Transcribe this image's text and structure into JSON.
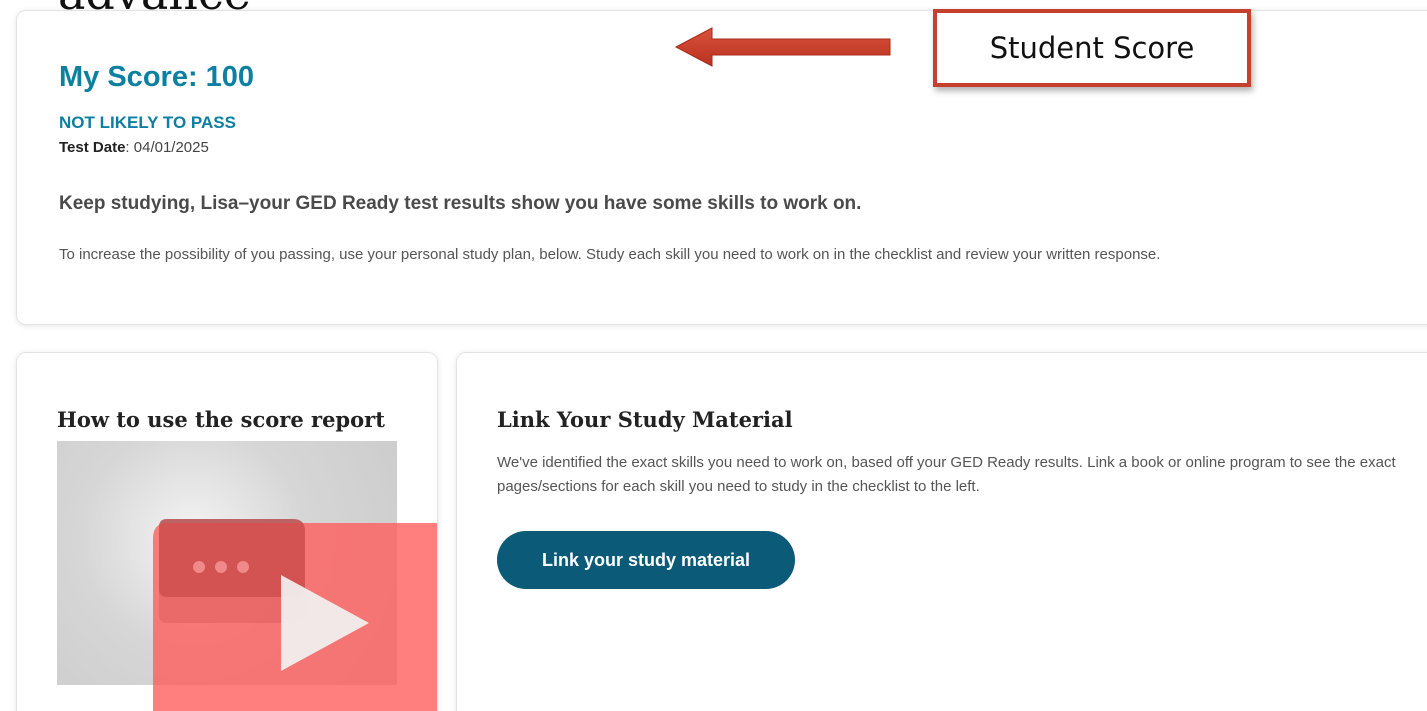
{
  "header": {
    "cropped_heading": "advance"
  },
  "score": {
    "title": "My Score: 100",
    "status": "NOT LIKELY TO PASS",
    "date_label": "Test Date",
    "date_value": ": 04/01/2025",
    "message_heading": "Keep studying, Lisa–your GED Ready test results show you have some skills to work on.",
    "message_body": "To increase the possibility of you passing, use your personal study plan, below. Study each skill you need to work on in the checklist and review your written response."
  },
  "annotation": {
    "label": "Student Score",
    "color": "#c7402f"
  },
  "video": {
    "title": "How to use the score report",
    "icon": "play-icon"
  },
  "study": {
    "title": "Link Your Study Material",
    "description": "We've identified the exact skills you need to work on, based off your GED Ready results. Link a book or online program to see the exact pages/sections for each skill you need to study in the checklist to the left.",
    "button_label": "Link your study material"
  },
  "colors": {
    "accent": "#0d7fa0",
    "button": "#0a5a78",
    "overlay_red": "#ff5a5a"
  }
}
